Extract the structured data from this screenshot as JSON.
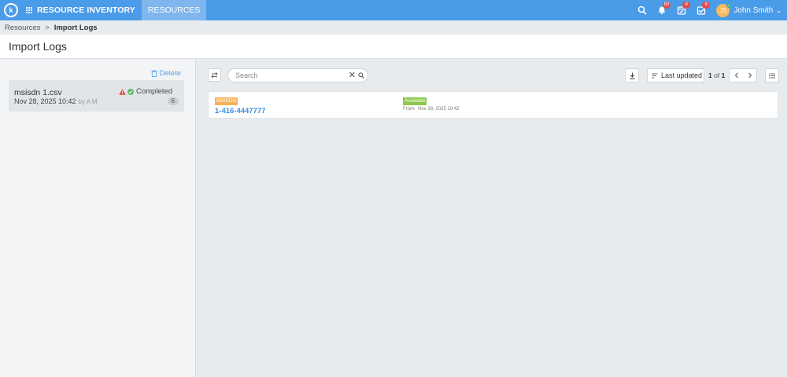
{
  "topbar": {
    "logo_text": "k",
    "app_name": "RESOURCE INVENTORY",
    "active_tab": "RESOURCES",
    "badges": {
      "notifications": "50",
      "tasks": "4",
      "approvals": "6"
    },
    "avatar_initials": "JS",
    "user_name": "John Smith",
    "colors": {
      "bar": "#4a9be8",
      "active_tab": "#7fb6ee",
      "badge": "#e34c4c"
    }
  },
  "breadcrumb": {
    "parent": "Resources",
    "separator": ">",
    "current": "Import Logs"
  },
  "page": {
    "title": "Import Logs"
  },
  "left_panel": {
    "delete_label": "Delete",
    "logs": [
      {
        "file_name": "msisdn 1.csv",
        "date": "Nov 28, 2025 10:42",
        "by": "by A M",
        "status": "Completed",
        "count": "6"
      }
    ]
  },
  "toolbar": {
    "search_placeholder": "Search",
    "search_value": "",
    "sort_label": "Last updated",
    "page_current": "1",
    "page_of": "of",
    "page_total": "1"
  },
  "results": [
    {
      "type": "MSISDN",
      "number": "1-416-4447777",
      "status": "Available",
      "from_label": "From:",
      "from_date": "Nov 28, 2025 10:42"
    }
  ]
}
